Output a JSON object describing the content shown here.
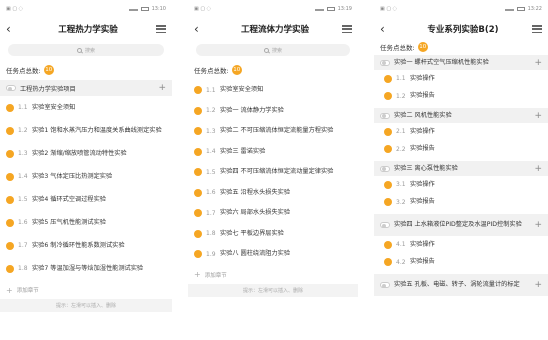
{
  "theme": {
    "accent": "#f5a623",
    "section_bg": "#f1f1f1"
  },
  "screens": [
    {
      "time": "13:10",
      "title": "工程热力学实验",
      "search_placeholder": "搜索",
      "total_label": "任务点总数:",
      "total_count": "10",
      "section": "工程热力学实验项目",
      "items": [
        {
          "num": "1.1",
          "text": "实验室安全须知"
        },
        {
          "num": "1.2",
          "text": "实验1 饱和水蒸汽压力和温度关系曲线测定实验"
        },
        {
          "num": "1.3",
          "text": "实验2 渐缩/缩放喷管流动特性实验"
        },
        {
          "num": "1.4",
          "text": "实验3 气体定压比热测定实验"
        },
        {
          "num": "1.5",
          "text": "实验4 循环式空调过程实验"
        },
        {
          "num": "1.6",
          "text": "实验5 压气机性能测试实验"
        },
        {
          "num": "1.7",
          "text": "实验6 制冷循环性能系数测试实验"
        },
        {
          "num": "1.8",
          "text": "实验7 等温加湿与等焓加湿性能测试实验"
        }
      ],
      "add_label": "添加章节",
      "hint": "提示：左滑可以插入、删除"
    },
    {
      "time": "13:19",
      "title": "工程流体力学实验",
      "search_placeholder": "搜索",
      "total_label": "任务点总数:",
      "total_count": "10",
      "items": [
        {
          "num": "1.1",
          "text": "实验室安全须知"
        },
        {
          "num": "1.2",
          "text": "实验一 流体静力学实验"
        },
        {
          "num": "1.3",
          "text": "实验二 不可压缩流体恒定流能量方程实验"
        },
        {
          "num": "1.4",
          "text": "实验三 雷诺实验"
        },
        {
          "num": "1.5",
          "text": "实验四 不可压缩流体恒定流动量定律实验"
        },
        {
          "num": "1.6",
          "text": "实验五 沿程水头损失实验"
        },
        {
          "num": "1.7",
          "text": "实验六 局部水头损失实验"
        },
        {
          "num": "1.8",
          "text": "实验七 平板边界层实验"
        },
        {
          "num": "1.9",
          "text": "实验八 圆柱绕流阻力实验"
        }
      ],
      "add_label": "添加章节",
      "hint": "提示：左滑可以插入、删除"
    },
    {
      "time": "13:22",
      "title": "专业系列实验B(2)",
      "total_label": "任务点总数:",
      "total_count": "10",
      "groups": [
        {
          "label": "实验一 螺杆式空气压缩机性能实验",
          "items": [
            {
              "num": "1.1",
              "text": "实验操作"
            },
            {
              "num": "1.2",
              "text": "实验报告"
            }
          ]
        },
        {
          "label": "实验二 风机性能实验",
          "items": [
            {
              "num": "2.1",
              "text": "实验操作"
            },
            {
              "num": "2.2",
              "text": "实验报告"
            }
          ]
        },
        {
          "label": "实验三 离心泵性能实验",
          "items": [
            {
              "num": "3.1",
              "text": "实验操作"
            },
            {
              "num": "3.2",
              "text": "实验报告"
            }
          ]
        },
        {
          "label": "实验四 上水箱液位PID整定及水温PID控制实验",
          "items": [
            {
              "num": "4.1",
              "text": "实验操作"
            },
            {
              "num": "4.2",
              "text": "实验报告"
            }
          ]
        },
        {
          "label": "实验五 孔板、电磁、转子、涡轮流量计的标定",
          "items": []
        }
      ]
    }
  ]
}
